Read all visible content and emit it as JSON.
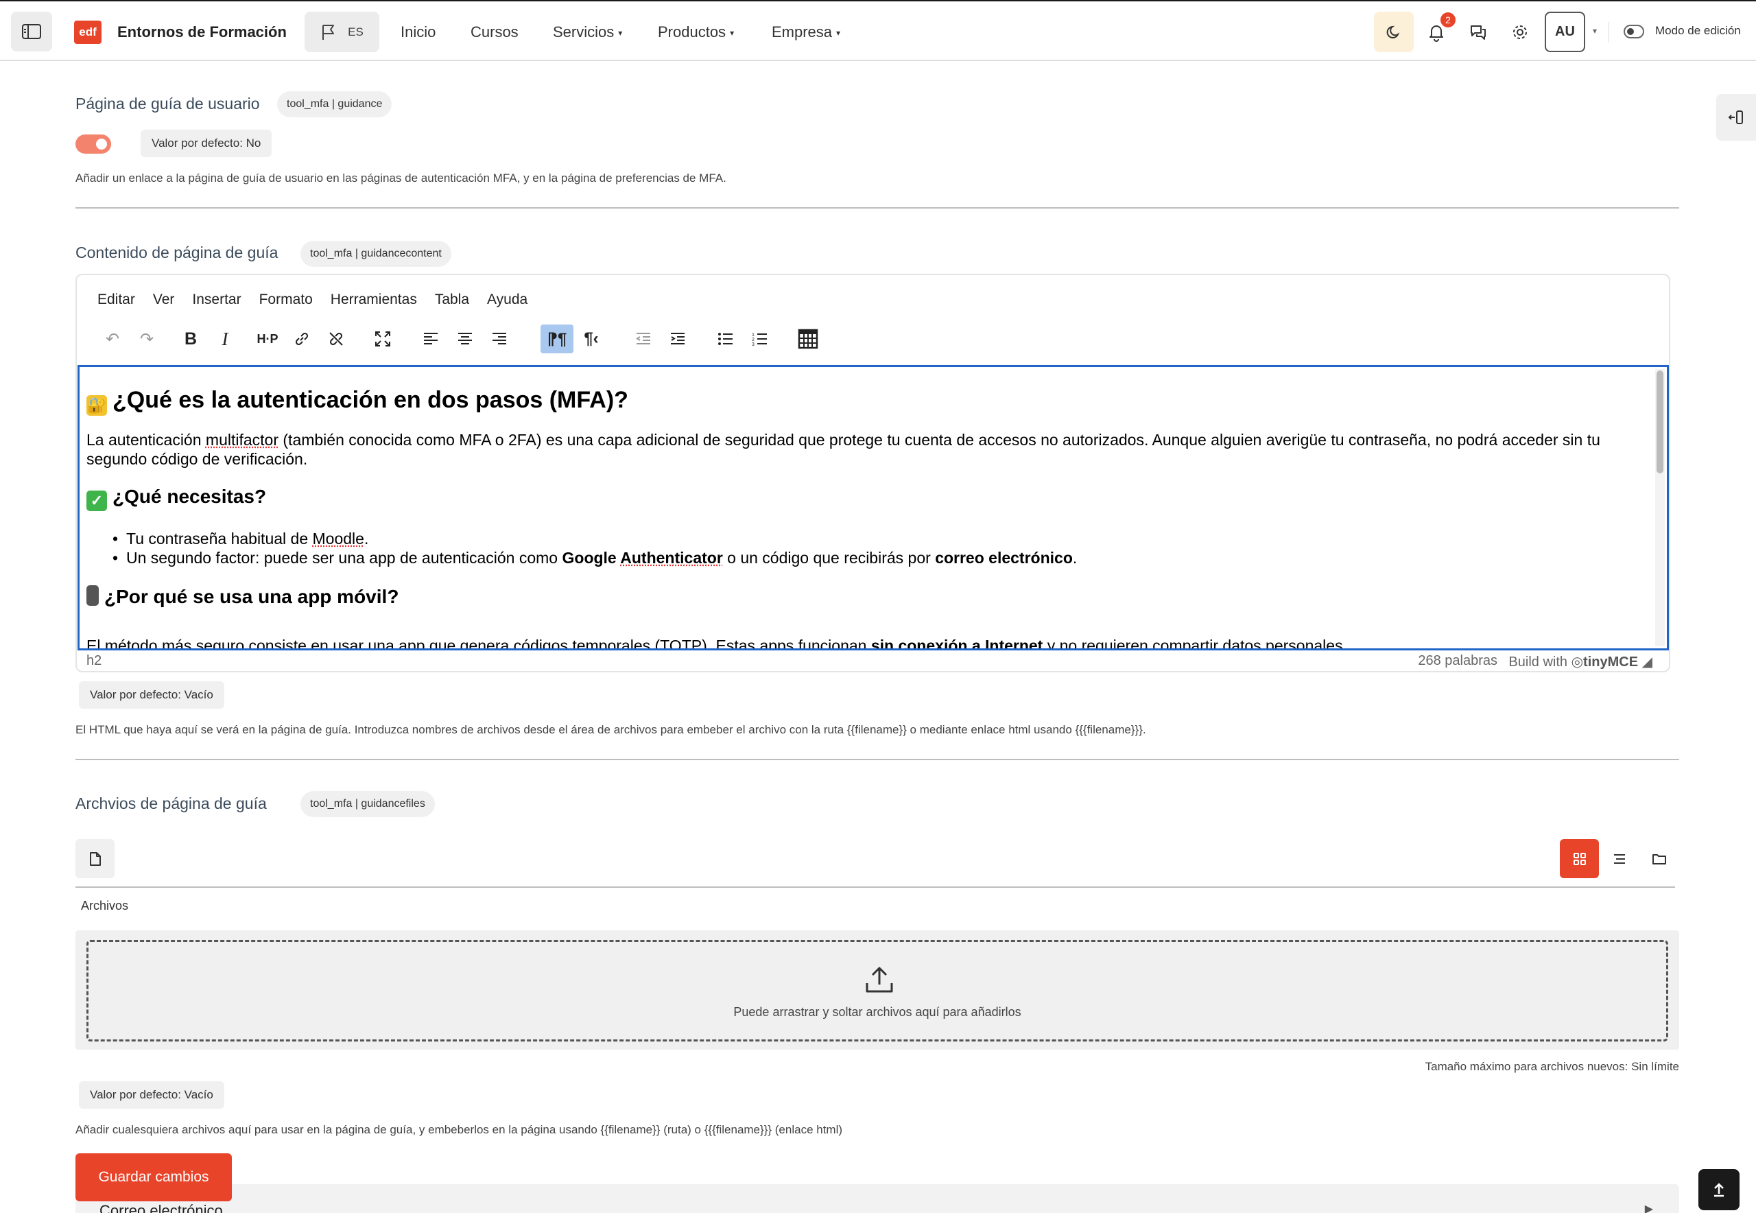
{
  "navbar": {
    "brand_logo": "edf",
    "brand": "Entornos de Formación",
    "lang": "ES",
    "links": [
      {
        "label": "Inicio",
        "has_menu": false
      },
      {
        "label": "Cursos",
        "has_menu": false
      },
      {
        "label": "Servicios",
        "has_menu": true
      },
      {
        "label": "Productos",
        "has_menu": true
      },
      {
        "label": "Empresa",
        "has_menu": true
      }
    ],
    "notif_count": "2",
    "avatar": "AU",
    "edit_mode": "Modo de edición",
    "accent": "#e8442a"
  },
  "guidance": {
    "title": "Página de guía de usuario",
    "tag": "tool_mfa | guidance",
    "default": "Valor por defecto: No",
    "enabled": true,
    "desc": "Añadir un enlace a la página de guía de usuario en las páginas de autenticación MFA, y en la página de preferencias de MFA."
  },
  "content_setting": {
    "title": "Contenido de página de guía",
    "tag": "tool_mfa | guidancecontent",
    "menu": [
      "Editar",
      "Ver",
      "Insertar",
      "Formato",
      "Herramientas",
      "Tabla",
      "Ayuda"
    ],
    "editor": {
      "h2": "¿Qué es la autenticación en dos pasos (MFA)?",
      "p1_a": "La autenticación ",
      "p1_b": "multifactor",
      "p1_c": " (también conocida como MFA o 2FA) es una capa adicional de seguridad que protege tu cuenta de accesos no autorizados. Aunque alguien averigüe tu contraseña, no podrá acceder sin tu segundo código de verificación.",
      "h3_1": "¿Qué necesitas?",
      "li1_a": "Tu contraseña habitual de ",
      "li1_b": "Moodle",
      "li1_c": ".",
      "li2_a": "Un segundo factor: puede ser una app de autenticación como ",
      "li2_b": "Google ",
      "li2_c": "Authenticator",
      "li2_d": " o un código que recibirás por ",
      "li2_e": "correo electrónico",
      "li2_f": ".",
      "h3_2": "¿Por qué se usa una app móvil?",
      "p2_a": "El método más seguro consiste en usar una app que genera códigos temporales (TOTP). Estas apps funcionan ",
      "p2_b": "sin conexión a Internet",
      "p2_c": " y no requieren compartir datos personales."
    },
    "status_path": "h2",
    "word_count": "268 palabras",
    "build_with": "Build with",
    "tinymce": "tinyMCE",
    "default": "Valor por defecto: Vacío",
    "desc": "El HTML que haya aquí se verá en la página de guía. Introduzca nombres de archivos desde el área de archivos para embeber el archivo con la ruta {{filename}} o mediante enlace html usando {{{filename}}}."
  },
  "files_setting": {
    "title": "Archvios de página de guía",
    "tag": "tool_mfa | guidancefiles",
    "files_label": "Archivos",
    "drop_text": "Puede arrastrar y soltar archivos aquí para añadirlos",
    "max_size": "Tamaño máximo para archivos nuevos: Sin límite",
    "default": "Valor por defecto: Vacío",
    "desc": "Añadir cualesquiera archivos aquí para usar en la página de guía, y embeberlos en la página usando {{filename}} (ruta) o {{{filename}}} (enlace html)"
  },
  "save_label": "Guardar cambios",
  "next_section": "Correo electrónico"
}
